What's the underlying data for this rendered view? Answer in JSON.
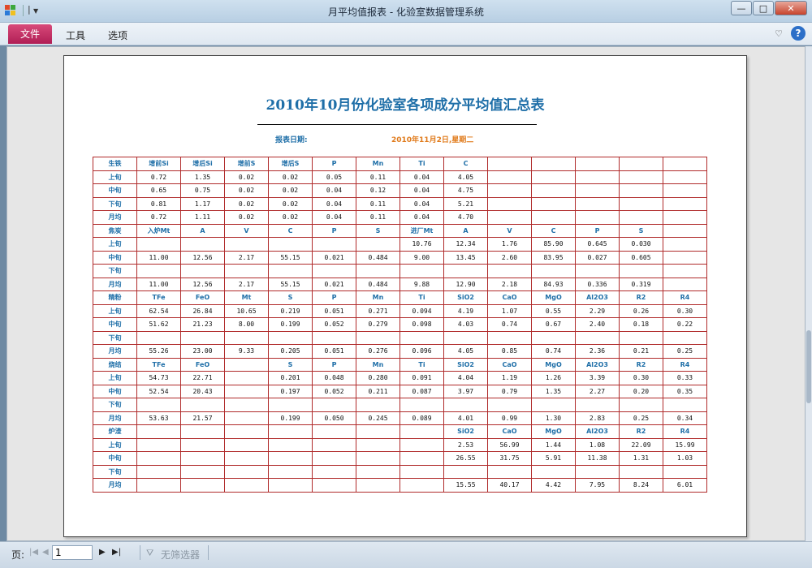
{
  "window": {
    "title": "月平均值报表 - 化验室数据管理系统",
    "qat_label": "|",
    "controls": {
      "minimize": "—",
      "maximize": "□",
      "close": "✕"
    }
  },
  "ribbon": {
    "tabs": [
      "文件",
      "工具",
      "选项"
    ],
    "collapse_label": "♡",
    "help_label": "?"
  },
  "report": {
    "title": "2010年10月份化验室各项成分平均值汇总表",
    "date_label": "报表日期:",
    "date_value": "2010年11月2日,星期二",
    "rows": [
      [
        "生铁",
        "增前Si",
        "增后Si",
        "增前S",
        "增后S",
        "P",
        "Mn",
        "Ti",
        "C",
        "",
        "",
        "",
        "",
        ""
      ],
      [
        "上旬",
        "0.72",
        "1.35",
        "0.02",
        "0.02",
        "0.05",
        "0.11",
        "0.04",
        "4.05",
        "",
        "",
        "",
        "",
        ""
      ],
      [
        "中旬",
        "0.65",
        "0.75",
        "0.02",
        "0.02",
        "0.04",
        "0.12",
        "0.04",
        "4.75",
        "",
        "",
        "",
        "",
        ""
      ],
      [
        "下旬",
        "0.81",
        "1.17",
        "0.02",
        "0.02",
        "0.04",
        "0.11",
        "0.04",
        "5.21",
        "",
        "",
        "",
        "",
        ""
      ],
      [
        "月均",
        "0.72",
        "1.11",
        "0.02",
        "0.02",
        "0.04",
        "0.11",
        "0.04",
        "4.70",
        "",
        "",
        "",
        "",
        ""
      ],
      [
        "焦炭",
        "入炉Mt",
        "A",
        "V",
        "C",
        "P",
        "S",
        "进厂Mt",
        "A",
        "V",
        "C",
        "P",
        "S",
        ""
      ],
      [
        "上旬",
        "",
        "",
        "",
        "",
        "",
        "",
        "10.76",
        "12.34",
        "1.76",
        "85.90",
        "0.645",
        "0.030",
        ""
      ],
      [
        "中旬",
        "11.00",
        "12.56",
        "2.17",
        "55.15",
        "0.021",
        "0.484",
        "9.00",
        "13.45",
        "2.60",
        "83.95",
        "0.027",
        "0.605",
        ""
      ],
      [
        "下旬",
        "",
        "",
        "",
        "",
        "",
        "",
        "",
        "",
        "",
        "",
        "",
        "",
        ""
      ],
      [
        "月均",
        "11.00",
        "12.56",
        "2.17",
        "55.15",
        "0.021",
        "0.484",
        "9.88",
        "12.90",
        "2.18",
        "84.93",
        "0.336",
        "0.319",
        ""
      ],
      [
        "精粉",
        "TFe",
        "FeO",
        "Mt",
        "S",
        "P",
        "Mn",
        "Ti",
        "SiO2",
        "CaO",
        "MgO",
        "Al2O3",
        "R2",
        "R4"
      ],
      [
        "上旬",
        "62.54",
        "26.84",
        "10.65",
        "0.219",
        "0.051",
        "0.271",
        "0.094",
        "4.19",
        "1.07",
        "0.55",
        "2.29",
        "0.26",
        "0.30"
      ],
      [
        "中旬",
        "51.62",
        "21.23",
        "8.00",
        "0.199",
        "0.052",
        "0.279",
        "0.098",
        "4.03",
        "0.74",
        "0.67",
        "2.40",
        "0.18",
        "0.22"
      ],
      [
        "下旬",
        "",
        "",
        "",
        "",
        "",
        "",
        "",
        "",
        "",
        "",
        "",
        "",
        ""
      ],
      [
        "月均",
        "55.26",
        "23.00",
        "9.33",
        "0.205",
        "0.051",
        "0.276",
        "0.096",
        "4.05",
        "0.85",
        "0.74",
        "2.36",
        "0.21",
        "0.25"
      ],
      [
        "烧结",
        "TFe",
        "FeO",
        "",
        "S",
        "P",
        "Mn",
        "Ti",
        "SiO2",
        "CaO",
        "MgO",
        "Al2O3",
        "R2",
        "R4"
      ],
      [
        "上旬",
        "54.73",
        "22.71",
        "",
        "0.201",
        "0.048",
        "0.280",
        "0.091",
        "4.04",
        "1.19",
        "1.26",
        "3.39",
        "0.30",
        "0.33"
      ],
      [
        "中旬",
        "52.54",
        "20.43",
        "",
        "0.197",
        "0.052",
        "0.211",
        "0.087",
        "3.97",
        "0.79",
        "1.35",
        "2.27",
        "0.20",
        "0.35"
      ],
      [
        "下旬",
        "",
        "",
        "",
        "",
        "",
        "",
        "",
        "",
        "",
        "",
        "",
        "",
        ""
      ],
      [
        "月均",
        "53.63",
        "21.57",
        "",
        "0.199",
        "0.050",
        "0.245",
        "0.089",
        "4.01",
        "0.99",
        "1.30",
        "2.83",
        "0.25",
        "0.34"
      ],
      [
        "炉渣",
        "",
        "",
        "",
        "",
        "",
        "",
        "",
        "SiO2",
        "CaO",
        "MgO",
        "Al2O3",
        "R2",
        "R4"
      ],
      [
        "上旬",
        "",
        "",
        "",
        "",
        "",
        "",
        "",
        "2.53",
        "56.99",
        "1.44",
        "1.08",
        "22.09",
        "15.99"
      ],
      [
        "中旬",
        "",
        "",
        "",
        "",
        "",
        "",
        "",
        "26.55",
        "31.75",
        "5.91",
        "11.38",
        "1.31",
        "1.03"
      ],
      [
        "下旬",
        "",
        "",
        "",
        "",
        "",
        "",
        "",
        "",
        "",
        "",
        "",
        "",
        ""
      ],
      [
        "月均",
        "",
        "",
        "",
        "",
        "",
        "",
        "",
        "15.55",
        "40.17",
        "4.42",
        "7.95",
        "8.24",
        "6.01"
      ]
    ],
    "header_row_indices": [
      0,
      5,
      10,
      15,
      20
    ]
  },
  "statusbar": {
    "page_label": "页:",
    "page_value": "1",
    "nav": {
      "first": "|◀",
      "prev": "◀",
      "next": "▶",
      "last": "▶|"
    },
    "filter_label": "无筛选器"
  },
  "colors": {
    "file_tab": "#b01e55",
    "report_title": "#1f6fa8",
    "date_value": "#e07a1a",
    "grid_border": "#b02a2a"
  }
}
